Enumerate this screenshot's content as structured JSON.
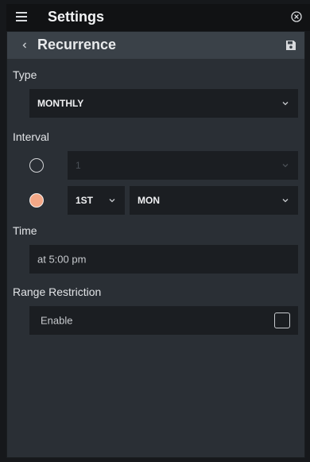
{
  "app": {
    "title": "Settings",
    "menu_icon": "hamburger-menu-icon",
    "close_icon": "close-circle-icon"
  },
  "subheader": {
    "title": "Recurrence",
    "back_icon": "chevron-left-icon",
    "save_icon": "save-floppy-icon"
  },
  "type": {
    "label": "Type",
    "selected": "MONTHLY"
  },
  "interval": {
    "label": "Interval",
    "option_day": {
      "selected": false,
      "value": "1"
    },
    "option_week": {
      "selected": true,
      "ordinal": "1ST",
      "weekday": "MON"
    }
  },
  "time": {
    "label": "Time",
    "value": "at 5:00 pm"
  },
  "range": {
    "label": "Range Restriction",
    "enable_label": "Enable",
    "enabled": false
  },
  "colors": {
    "accent": "#f4a887",
    "panel": "#2a2f35",
    "field": "#1b1e22",
    "header": "#3a4148"
  }
}
